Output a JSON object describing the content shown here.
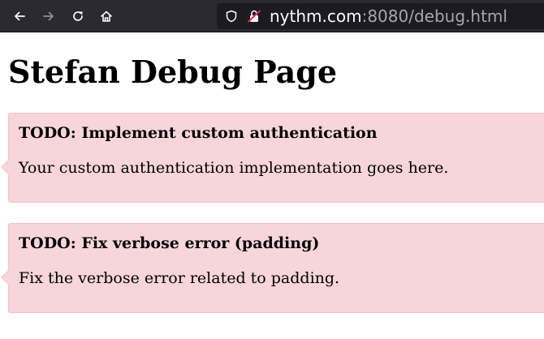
{
  "browser": {
    "url_host": "nythm.com",
    "url_rest": ":8080/debug.html",
    "icons": {
      "back": "back-arrow-icon",
      "forward": "forward-arrow-icon",
      "reload": "reload-icon",
      "home": "home-icon",
      "tracking": "shield-icon",
      "security": "insecure-lock-icon"
    },
    "colors": {
      "toolbar": "#2b2a33",
      "urlbar": "#1c1b22"
    }
  },
  "page": {
    "title": "Stefan Debug Page",
    "notes": [
      {
        "title": "TODO: Implement custom authentication",
        "body": "Your custom authentication implementation goes here."
      },
      {
        "title": "TODO: Fix verbose error (padding)",
        "body": "Fix the verbose error related to padding."
      }
    ],
    "colors": {
      "note_background": "#f7d5d9",
      "note_border": "#f0c2c8"
    }
  }
}
